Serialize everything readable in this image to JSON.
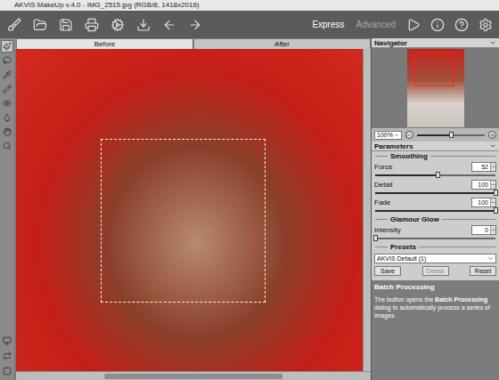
{
  "window": {
    "title": "AKVIS MakeUp v.4.0 - IMG_2515.jpg (RGB/8, 1418x2016)"
  },
  "modes": [
    {
      "label": "Express",
      "selected": true
    },
    {
      "label": "Advanced",
      "selected": false
    }
  ],
  "tools": [
    {
      "selected": true
    },
    {
      "selected": false
    },
    {
      "selected": false
    },
    {
      "selected": false
    },
    {
      "selected": false
    },
    {
      "selected": false
    },
    {
      "selected": false
    },
    {
      "selected": false
    }
  ],
  "tabs": [
    {
      "label": "Before",
      "selected": true
    },
    {
      "label": "After",
      "selected": false
    }
  ],
  "navigator": {
    "title": "Navigator",
    "zoom": "100%",
    "level": 0.5
  },
  "parameters": {
    "title": "Parameters",
    "groups": [
      {
        "title": "Smoothing",
        "sliders": [
          {
            "label": "Force",
            "value": "52",
            "level": 0.52
          },
          {
            "label": "Detail",
            "value": "100",
            "level": 1
          },
          {
            "label": "Fade",
            "value": "100",
            "level": 1
          }
        ]
      },
      {
        "title": "Glamour Glow",
        "sliders": [
          {
            "label": "Intensity",
            "value": "0",
            "level": 0
          }
        ]
      }
    ]
  },
  "presets": {
    "title": "Presets",
    "selected": "AKVIS Default (1)",
    "buttons": [
      {
        "label": "Save",
        "disabled": false
      },
      {
        "label": "Delete",
        "disabled": true
      },
      {
        "label": "Reset",
        "disabled": false
      }
    ]
  },
  "hint": {
    "title": "Batch Processing",
    "parts": [
      {
        "text": "The button opens the ",
        "bold": false
      },
      {
        "text": "Batch Processing",
        "bold": true
      },
      {
        "text": " dialog to automatically process a series of images.",
        "bold": false
      }
    ]
  }
}
